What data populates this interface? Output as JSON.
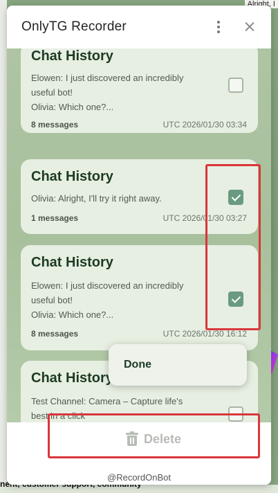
{
  "background": {
    "top_snippet": "Alright, I",
    "bottom_text": "nent, customer support, community"
  },
  "dialog": {
    "title": "OnlyTG Recorder",
    "menu_icon": "kebab-vertical-icon",
    "close_icon": "close-icon"
  },
  "chats": [
    {
      "title": "Chat History",
      "preview_lines": [
        "Elowen: I just discovered an incredibly",
        "useful bot!",
        "Olivia: Which one?..."
      ],
      "count": "8 messages",
      "time": "UTC 2026/01/30 03:34",
      "checked": false
    },
    {
      "title": "Chat History",
      "preview_lines": [
        "Olivia: Alright, I'll try it right away."
      ],
      "count": "1 messages",
      "time": "UTC 2026/01/30 03:27",
      "checked": true
    },
    {
      "title": "Chat History",
      "preview_lines": [
        "Elowen: I just discovered an incredibly",
        "useful bot!",
        "Olivia: Which one?..."
      ],
      "count": "8 messages",
      "time": "UTC 2026/01/30 16:12",
      "checked": true
    },
    {
      "title": "Chat History",
      "preview_lines": [
        "Test Channel: Camera – Capture life's",
        "best in a click"
      ],
      "count": "",
      "time": "",
      "checked": false
    }
  ],
  "popup": {
    "done_label": "Done"
  },
  "footer": {
    "delete_label": "Delete",
    "credit": "@RecordOnBot"
  },
  "colors": {
    "accent": "#1d3a25",
    "checkbox_checked": "#6a9a80",
    "highlight": "#d9363b",
    "disabled": "#b8bcb6"
  }
}
